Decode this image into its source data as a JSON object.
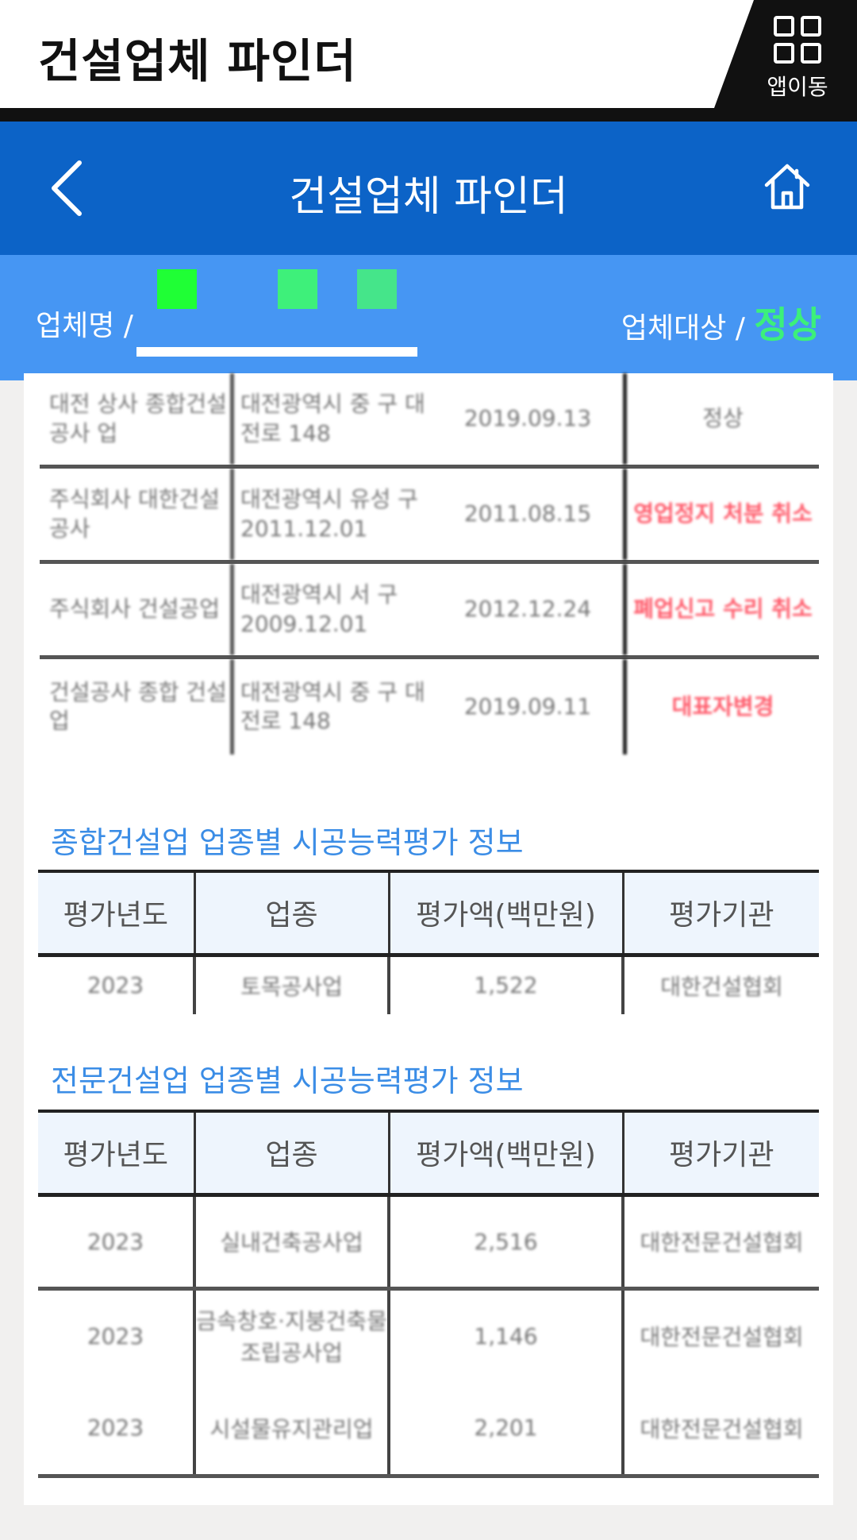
{
  "topbar": {
    "title": "건설업체 파인더",
    "app_move_label": "앱이동"
  },
  "navbar": {
    "title": "건설업체 파인더"
  },
  "info": {
    "name_label": "업체명 /",
    "target_label": "업체대상 /",
    "status": "정상"
  },
  "upper_rows": [
    {
      "c1": "대전 상사 종합건설공사 업",
      "c2": "대전광역시 중 구 대전로 148",
      "c3": "2019.09.13",
      "c4": "정상",
      "red": false
    },
    {
      "c1": "주식회사 대한건설 공사",
      "c2": "대전광역시 유성 구 2011.12.01",
      "c3": "2011.08.15",
      "c4": "영업정지 처분 취소",
      "red": true
    },
    {
      "c1": "주식회사 건설공업",
      "c2": "대전광역시 서 구 2009.12.01",
      "c3": "2012.12.24",
      "c4": "폐업신고 수리 취소",
      "red": true
    },
    {
      "c1": "건설공사 종합 건설업",
      "c2": "대전광역시 중 구 대전로 148",
      "c3": "2019.09.11",
      "c4": "대표자변경",
      "red": true
    }
  ],
  "general": {
    "title": "종합건설업 업종별 시공능력평가 정보",
    "headers": [
      "평가년도",
      "업종",
      "평가액(백만원)",
      "평가기관"
    ],
    "rows": [
      [
        "2023",
        "토목공사업",
        "1,522",
        "대한건설협회"
      ]
    ]
  },
  "specialty": {
    "title": "전문건설업 업종별 시공능력평가 정보",
    "headers": [
      "평가년도",
      "업종",
      "평가액(백만원)",
      "평가기관"
    ],
    "rows": [
      [
        "2023",
        "실내건축공사업",
        "2,516",
        "대한전문건설협회"
      ],
      [
        "2023",
        "금속창호·지붕건축물조립공사업",
        "1,146",
        "대한전문건설협회"
      ],
      [
        "2023",
        "시설물유지관리업",
        "2,201",
        "대한전문건설협회"
      ]
    ]
  },
  "colors": {
    "primary_blue": "#0c63c7",
    "info_blue": "#4696f3",
    "status_green": "#3cf07a",
    "section_title_blue": "#3b8de6",
    "alert_red": "#ff5a6a"
  }
}
